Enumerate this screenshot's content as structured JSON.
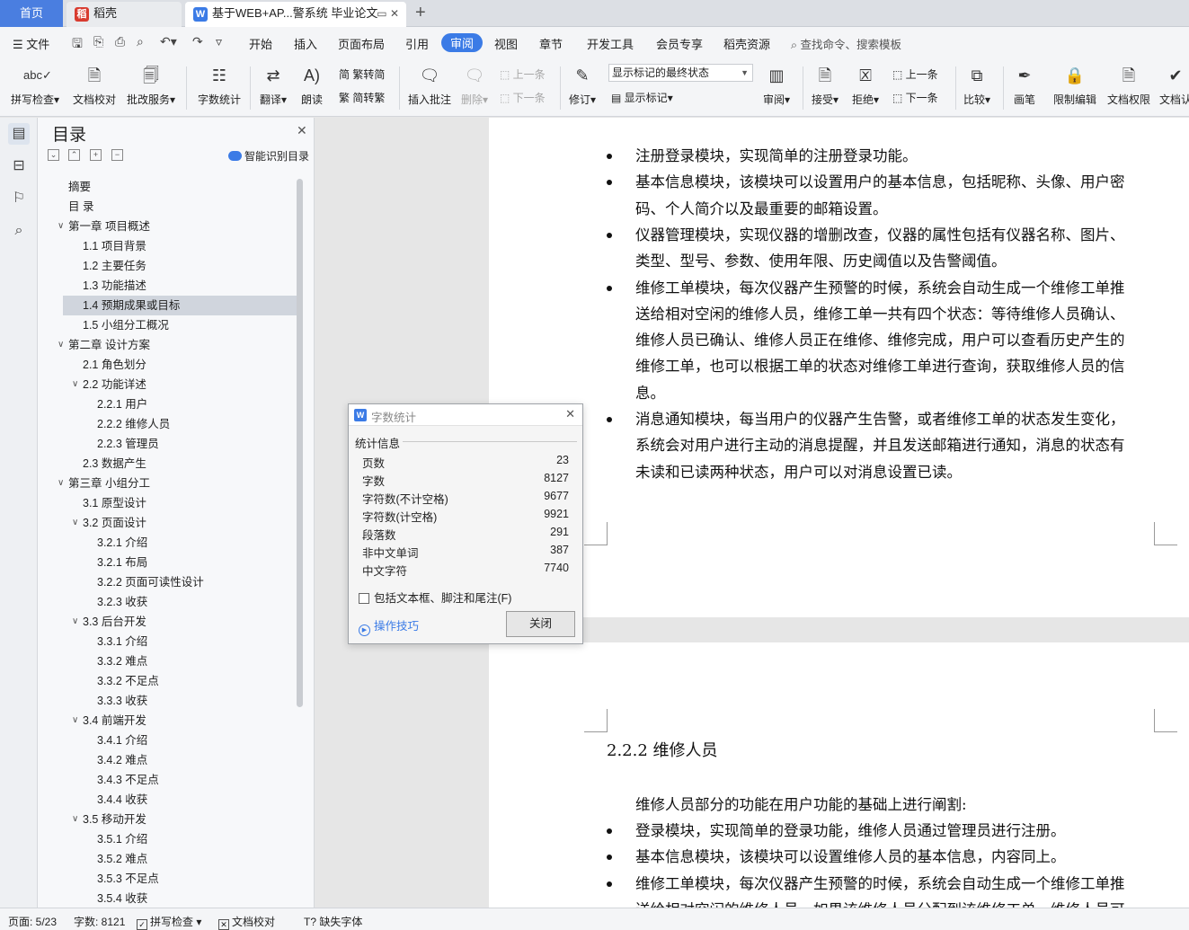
{
  "tabs": {
    "home": "首页",
    "daoke": "稻壳",
    "doc": "基于WEB+AP...警系统 毕业论文"
  },
  "menu": {
    "file": "文件",
    "items": [
      "开始",
      "插入",
      "页面布局",
      "引用",
      "审阅",
      "视图",
      "章节",
      "开发工具",
      "会员专享",
      "稻壳资源"
    ],
    "active": "审阅",
    "search": "查找命令、搜索模板"
  },
  "ribbon": {
    "spell": "拼写检查",
    "doc_check": "文档校对",
    "correct_service": "批改服务",
    "word_count": "字数统计",
    "translate": "翻译",
    "read_aloud": "朗读",
    "trad_to_simp": "繁转简",
    "simp_to_trad": "简转繁",
    "insert_comment": "插入批注",
    "delete": "删除",
    "prev_comment": "上一条",
    "next_comment": "下一条",
    "track": "修订",
    "markup_select": "显示标记的最终状态",
    "show_markup": "显示标记",
    "review": "审阅",
    "accept": "接受",
    "reject": "拒绝",
    "prev_change": "上一条",
    "next_change": "下一条",
    "compare": "比较",
    "pen": "画笔",
    "restrict_edit": "限制编辑",
    "doc_permission": "文档权限",
    "doc_cert": "文档认"
  },
  "toc": {
    "title": "目录",
    "smart": "智能识别目录",
    "items": [
      {
        "text": "摘要",
        "level": 0
      },
      {
        "text": "目 录",
        "level": 0
      },
      {
        "text": "第一章 项目概述",
        "level": 0,
        "expand": true
      },
      {
        "text": "1.1 项目背景",
        "level": 1
      },
      {
        "text": "1.2 主要任务",
        "level": 1
      },
      {
        "text": "1.3 功能描述",
        "level": 1
      },
      {
        "text": "1.4 预期成果或目标",
        "level": 1,
        "selected": true
      },
      {
        "text": "1.5 小组分工概况",
        "level": 1
      },
      {
        "text": "第二章 设计方案",
        "level": 0,
        "expand": true
      },
      {
        "text": "2.1 角色划分",
        "level": 1
      },
      {
        "text": "2.2 功能详述",
        "level": 1,
        "expand": true
      },
      {
        "text": "2.2.1 用户",
        "level": 2
      },
      {
        "text": "2.2.2 维修人员",
        "level": 2
      },
      {
        "text": "2.2.3 管理员",
        "level": 2
      },
      {
        "text": "2.3 数据产生",
        "level": 1
      },
      {
        "text": "第三章 小组分工",
        "level": 0,
        "expand": true
      },
      {
        "text": "3.1 原型设计",
        "level": 1
      },
      {
        "text": "3.2 页面设计",
        "level": 1,
        "expand": true
      },
      {
        "text": "3.2.1 介绍",
        "level": 2
      },
      {
        "text": "3.2.1 布局",
        "level": 2
      },
      {
        "text": "3.2.2 页面可读性设计",
        "level": 2
      },
      {
        "text": "3.2.3 收获",
        "level": 2
      },
      {
        "text": "3.3 后台开发",
        "level": 1,
        "expand": true
      },
      {
        "text": "3.3.1 介绍",
        "level": 2
      },
      {
        "text": "3.3.2 难点",
        "level": 2
      },
      {
        "text": "3.3.2 不足点",
        "level": 2
      },
      {
        "text": "3.3.3 收获",
        "level": 2
      },
      {
        "text": "3.4 前端开发",
        "level": 1,
        "expand": true
      },
      {
        "text": "3.4.1 介绍",
        "level": 2
      },
      {
        "text": "3.4.2 难点",
        "level": 2
      },
      {
        "text": "3.4.3 不足点",
        "level": 2
      },
      {
        "text": "3.4.4 收获",
        "level": 2
      },
      {
        "text": "3.5 移动开发",
        "level": 1,
        "expand": true
      },
      {
        "text": "3.5.1 介绍",
        "level": 2
      },
      {
        "text": "3.5.2 难点",
        "level": 2
      },
      {
        "text": "3.5.3 不足点",
        "level": 2
      },
      {
        "text": "3.5.4 收获",
        "level": 2
      }
    ]
  },
  "doc": {
    "page1_lines": [
      {
        "text": "注册登录模块，实现简单的注册登录功能。",
        "bullet": true
      },
      {
        "text": "基本信息模块，该模块可以设置用户的基本信息，包括昵称、头像、用户密",
        "bullet": true
      },
      {
        "text": "码、个人简介以及最重要的邮箱设置。",
        "bullet": false
      },
      {
        "text": "仪器管理模块，实现仪器的增删改查，仪器的属性包括有仪器名称、图片、",
        "bullet": true
      },
      {
        "text": "类型、型号、参数、使用年限、历史阈值以及告警阈值。",
        "bullet": false
      },
      {
        "text": "维修工单模块，每次仪器产生预警的时候，系统会自动生成一个维修工单推",
        "bullet": true
      },
      {
        "text": "送给相对空闲的维修人员，维修工单一共有四个状态：等待维修人员确认、",
        "bullet": false
      },
      {
        "text": "维修人员已确认、维修人员正在维修、维修完成，用户可以查看历史产生的",
        "bullet": false
      },
      {
        "text": "维修工单，也可以根据工单的状态对维修工单进行查询，获取维修人员的信",
        "bullet": false
      },
      {
        "text": "息。",
        "bullet": false
      },
      {
        "text": "消息通知模块，每当用户的仪器产生告警，或者维修工单的状态发生变化，",
        "bullet": true
      },
      {
        "text": "系统会对用户进行主动的消息提醒，并且发送邮箱进行通知，消息的状态有",
        "bullet": false
      },
      {
        "text": "未读和已读两种状态，用户可以对消息设置已读。",
        "bullet": false
      }
    ],
    "section_heading": "2.2.2  维修人员",
    "intro": "维修人员部分的功能在用户功能的基础上进行阐割:",
    "page2_lines": [
      {
        "text": "登录模块，实现简单的登录功能，维修人员通过管理员进行注册。",
        "bullet": true
      },
      {
        "text": "基本信息模块，该模块可以设置维修人员的基本信息，内容同上。",
        "bullet": true
      },
      {
        "text": "维修工单模块，每次仪器产生预警的时候，系统会自动生成一个维修工单推",
        "bullet": true
      },
      {
        "text": "送给相对空闲的维修人员，如果该维修人员分配到该维修工单，维修人员可",
        "bullet": false
      }
    ]
  },
  "dialog": {
    "title": "字数统计",
    "group": "统计信息",
    "rows": [
      {
        "label": "页数",
        "value": "23"
      },
      {
        "label": "字数",
        "value": "8127"
      },
      {
        "label": "字符数(不计空格)",
        "value": "9677"
      },
      {
        "label": "字符数(计空格)",
        "value": "9921"
      },
      {
        "label": "段落数",
        "value": "291"
      },
      {
        "label": "非中文单词",
        "value": "387"
      },
      {
        "label": "中文字符",
        "value": "7740"
      }
    ],
    "checkbox": "包括文本框、脚注和尾注(F)",
    "tips": "操作技巧",
    "close": "关闭"
  },
  "status": {
    "page": "页面: 5/23",
    "words": "字数: 8121",
    "spell": "拼写检查",
    "doc_check": "文档校对",
    "missing_font": "缺失字体"
  },
  "colors": {
    "accent": "#3b7be6",
    "home_tab": "#4a7ee0"
  }
}
